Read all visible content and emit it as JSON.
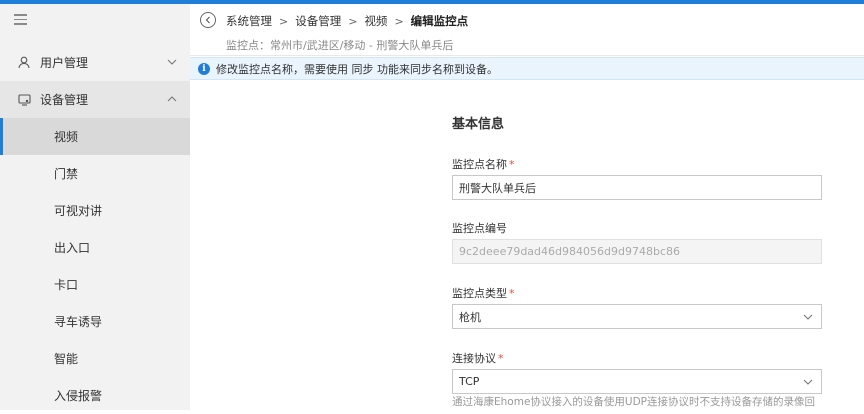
{
  "sidebar": {
    "groups": [
      {
        "label": "用户管理",
        "icon": "user-icon",
        "expanded": false
      },
      {
        "label": "设备管理",
        "icon": "device-icon",
        "expanded": true
      }
    ],
    "sub_items": [
      {
        "label": "视频",
        "active": true
      },
      {
        "label": "门禁",
        "active": false
      },
      {
        "label": "可视对讲",
        "active": false
      },
      {
        "label": "出入口",
        "active": false
      },
      {
        "label": "卡口",
        "active": false
      },
      {
        "label": "寻车诱导",
        "active": false
      },
      {
        "label": "智能",
        "active": false
      },
      {
        "label": "入侵报警",
        "active": false
      }
    ]
  },
  "header": {
    "breadcrumbs": [
      "系统管理",
      "设备管理",
      "视频",
      "编辑监控点"
    ],
    "subtitle": "监控点：常州市/武进区/移动 - 刑警大队单兵后"
  },
  "info_bar": {
    "text": "修改监控点名称，需要使用 同步 功能来同步名称到设备。"
  },
  "form": {
    "section_title": "基本信息",
    "fields": {
      "name": {
        "label": "监控点名称",
        "required": true,
        "value": "刑警大队单兵后"
      },
      "code": {
        "label": "监控点编号",
        "required": false,
        "value": "9c2deee79dad46d984056d9d9748bc86"
      },
      "type": {
        "label": "监控点类型",
        "required": true,
        "value": "枪机"
      },
      "protocol": {
        "label": "连接协议",
        "required": true,
        "value": "TCP"
      }
    },
    "protocol_hint": "通过海康Ehome协议接入的设备使用UDP连接协议时不支持设备存储的录像回"
  },
  "colors": {
    "accent": "#1f7fd8",
    "required": "#e84b3c",
    "info_bg": "#eaf4fd"
  }
}
